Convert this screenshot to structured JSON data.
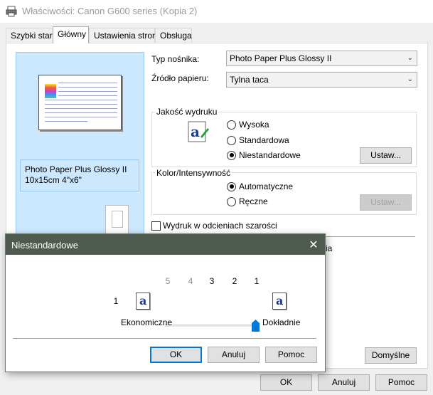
{
  "window": {
    "title": "Właściwości: Canon G600 series (Kopia 2)",
    "tabs": [
      {
        "label": "Szybki start"
      },
      {
        "label": "Główny"
      },
      {
        "label": "Ustawienia strony"
      },
      {
        "label": "Obsługa"
      }
    ],
    "active_tab": "Główny"
  },
  "preview": {
    "media_line1": "Photo Paper Plus Glossy II",
    "media_line2": "10x15cm 4\"x6\""
  },
  "form": {
    "media_type_label": "Typ nośnika:",
    "media_type_value": "Photo Paper Plus Glossy II",
    "paper_source_label": "Źródło papieru:",
    "paper_source_value": "Tylna taca",
    "quality_group": "Jakość wydruku",
    "quality_options": [
      "Wysoka",
      "Standardowa",
      "Niestandardowe"
    ],
    "quality_selected": "Niestandardowe",
    "quality_set_button": "Ustaw...",
    "color_group": "Kolor/Intensywność",
    "color_options": [
      "Automatyczne",
      "Ręczne"
    ],
    "color_selected": "Automatyczne",
    "color_set_button": "Ustaw...",
    "grayscale_label": "Wydruk w odcieniach szarości",
    "grayscale_checked": false,
    "partial_text": "ia",
    "defaults_button": "Domyślne"
  },
  "footer": {
    "ok": "OK",
    "cancel": "Anuluj",
    "help": "Pomoc"
  },
  "dialog": {
    "title": "Niestandardowe",
    "close_glyph": "✕",
    "scale_ticks": [
      "5",
      "4",
      "3",
      "2",
      "1"
    ],
    "left_number": "1",
    "slider_value": 1,
    "left_caption": "Ekonomiczne",
    "right_caption": "Dokładnie",
    "icon_glyph": "a",
    "ok": "OK",
    "cancel": "Anuluj",
    "help": "Pomoc"
  },
  "colors": {
    "preview_bg": "#cce8ff",
    "dialog_titlebar": "#4f5b4f",
    "accent": "#0078d7"
  },
  "icons": [
    "printer-icon",
    "print-quality-icon",
    "close-icon",
    "document-a-icon",
    "chevron-down-icon"
  ]
}
